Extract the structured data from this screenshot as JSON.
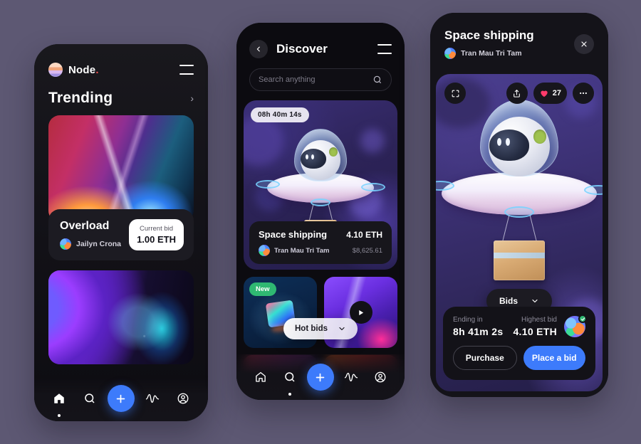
{
  "background_color": "#5d5873",
  "accent_color": "#3d7bfb",
  "phone1": {
    "brand": {
      "name": "Node",
      "dot": "."
    },
    "menu_icon": "hamburger-icon",
    "section": {
      "title": "Trending",
      "chevron": "›"
    },
    "cards": [
      {
        "title": "Overload",
        "author": "Jailyn Crona",
        "bid_label": "Current bid",
        "bid_value": "1.00 ETH"
      }
    ],
    "nav": [
      {
        "name": "home",
        "active": true
      },
      {
        "name": "search",
        "active": false
      },
      {
        "name": "add",
        "active": false
      },
      {
        "name": "activity",
        "active": false
      },
      {
        "name": "profile",
        "active": false
      }
    ]
  },
  "phone2": {
    "header": {
      "back_icon": "chevron-left-icon",
      "title": "Discover",
      "menu_icon": "hamburger-icon"
    },
    "search": {
      "placeholder": "Search anything",
      "value": "",
      "icon": "search-icon"
    },
    "feature": {
      "timer": "08h 40m 14s",
      "title": "Space shipping",
      "price": "4.10 ETH",
      "author": "Tran Mau Tri Tam",
      "usd": "$8,625.61"
    },
    "tiles": [
      {
        "badge": "New"
      },
      {
        "play_icon": "play-icon"
      }
    ],
    "filter_pill": {
      "label": "Hot bids",
      "chevron_icon": "chevron-down-icon"
    },
    "nav": [
      {
        "name": "home",
        "active": false
      },
      {
        "name": "search",
        "active": true
      },
      {
        "name": "add",
        "active": false
      },
      {
        "name": "activity",
        "active": false
      },
      {
        "name": "profile",
        "active": false
      }
    ]
  },
  "phone3": {
    "title": "Space shipping",
    "author": "Tran Mau Tri Tam",
    "close_icon": "close-icon",
    "hero_actions": {
      "fullscreen_icon": "fullscreen-icon",
      "share_icon": "share-icon",
      "like_icon": "heart-icon",
      "like_count": "27",
      "more_icon": "more-icon"
    },
    "bids_pill": {
      "label": "Bids",
      "chevron_icon": "chevron-down-icon"
    },
    "panel": {
      "ending_label": "Ending in",
      "ending_value": "8h 41m 2s",
      "highest_label": "Highest bid",
      "highest_value": "4.10 ETH",
      "verified_icon": "check-icon",
      "purchase_label": "Purchase",
      "bid_label": "Place a bid"
    }
  }
}
